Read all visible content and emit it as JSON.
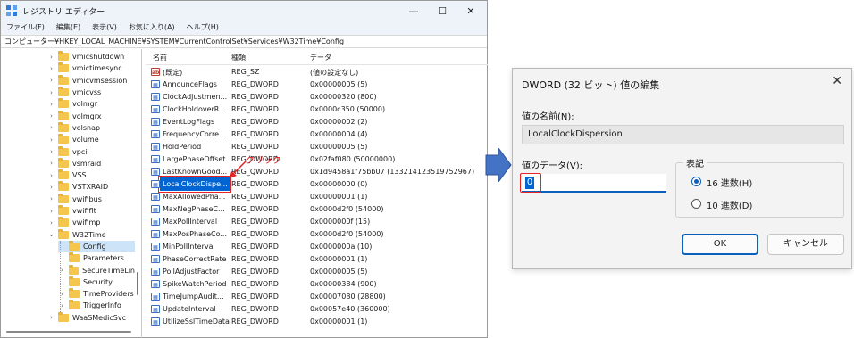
{
  "regedit": {
    "title": "レジストリ エディター",
    "menus": [
      "ファイル(F)",
      "編集(E)",
      "表示(V)",
      "お気に入り(A)",
      "ヘルプ(H)"
    ],
    "address": "コンピューター¥HKEY_LOCAL_MACHINE¥SYSTEM¥CurrentControlSet¥Services¥W32Time¥Config",
    "tree": [
      {
        "label": "vmicshutdown",
        "level": 0,
        "expander": "›"
      },
      {
        "label": "vmictimesync",
        "level": 0,
        "expander": "›"
      },
      {
        "label": "vmicvmsession",
        "level": 0,
        "expander": "›"
      },
      {
        "label": "vmicvss",
        "level": 0,
        "expander": "›"
      },
      {
        "label": "volmgr",
        "level": 0,
        "expander": "›"
      },
      {
        "label": "volmgrx",
        "level": 0,
        "expander": "›"
      },
      {
        "label": "volsnap",
        "level": 0,
        "expander": "›"
      },
      {
        "label": "volume",
        "level": 0,
        "expander": "›"
      },
      {
        "label": "vpci",
        "level": 0,
        "expander": "›"
      },
      {
        "label": "vsmraid",
        "level": 0,
        "expander": "›"
      },
      {
        "label": "VSS",
        "level": 0,
        "expander": "›"
      },
      {
        "label": "VSTXRAID",
        "level": 0,
        "expander": "›"
      },
      {
        "label": "vwifibus",
        "level": 0,
        "expander": "›"
      },
      {
        "label": "vwififlt",
        "level": 0,
        "expander": "›"
      },
      {
        "label": "vwifimp",
        "level": 0,
        "expander": "›"
      },
      {
        "label": "W32Time",
        "level": 0,
        "expander": "⌄"
      },
      {
        "label": "Config",
        "level": 1,
        "expander": "",
        "selected": true
      },
      {
        "label": "Parameters",
        "level": 1,
        "expander": ""
      },
      {
        "label": "SecureTimeLin",
        "level": 1,
        "expander": "›"
      },
      {
        "label": "Security",
        "level": 1,
        "expander": ""
      },
      {
        "label": "TimeProviders",
        "level": 1,
        "expander": "›"
      },
      {
        "label": "TriggerInfo",
        "level": 1,
        "expander": "›"
      },
      {
        "label": "WaaSMedicSvc",
        "level": 0,
        "expander": "›"
      }
    ],
    "columns": {
      "name": "名前",
      "type": "種類",
      "data": "データ"
    },
    "values": [
      {
        "icon": "ab",
        "name": "(既定)",
        "type": "REG_SZ",
        "data": "(値の設定なし)"
      },
      {
        "icon": "dw",
        "name": "AnnounceFlags",
        "type": "REG_DWORD",
        "data": "0x00000005 (5)"
      },
      {
        "icon": "dw",
        "name": "ClockAdjustmen...",
        "type": "REG_DWORD",
        "data": "0x00000320 (800)"
      },
      {
        "icon": "dw",
        "name": "ClockHoldoverR...",
        "type": "REG_DWORD",
        "data": "0x0000c350 (50000)"
      },
      {
        "icon": "dw",
        "name": "EventLogFlags",
        "type": "REG_DWORD",
        "data": "0x00000002 (2)"
      },
      {
        "icon": "dw",
        "name": "FrequencyCorre...",
        "type": "REG_DWORD",
        "data": "0x00000004 (4)"
      },
      {
        "icon": "dw",
        "name": "HoldPeriod",
        "type": "REG_DWORD",
        "data": "0x00000005 (5)"
      },
      {
        "icon": "dw",
        "name": "LargePhaseOffset",
        "type": "REG_DWORD",
        "data": "0x02faf080 (50000000)"
      },
      {
        "icon": "dw",
        "name": "LastKnownGood...",
        "type": "REG_QWORD",
        "data": "0x1d9458a1f75bb07 (133214123519752967)"
      },
      {
        "icon": "dw",
        "name": "LocalClockDispe...",
        "type": "REG_DWORD",
        "data": "0x00000000 (0)",
        "highlighted": true
      },
      {
        "icon": "dw",
        "name": "MaxAllowedPha...",
        "type": "REG_DWORD",
        "data": "0x00000001 (1)"
      },
      {
        "icon": "dw",
        "name": "MaxNegPhaseC...",
        "type": "REG_DWORD",
        "data": "0x0000d2f0 (54000)"
      },
      {
        "icon": "dw",
        "name": "MaxPollInterval",
        "type": "REG_DWORD",
        "data": "0x0000000f (15)"
      },
      {
        "icon": "dw",
        "name": "MaxPosPhaseCo...",
        "type": "REG_DWORD",
        "data": "0x0000d2f0 (54000)"
      },
      {
        "icon": "dw",
        "name": "MinPollInterval",
        "type": "REG_DWORD",
        "data": "0x0000000a (10)"
      },
      {
        "icon": "dw",
        "name": "PhaseCorrectRate",
        "type": "REG_DWORD",
        "data": "0x00000001 (1)"
      },
      {
        "icon": "dw",
        "name": "PollAdjustFactor",
        "type": "REG_DWORD",
        "data": "0x00000005 (5)"
      },
      {
        "icon": "dw",
        "name": "SpikeWatchPeriod",
        "type": "REG_DWORD",
        "data": "0x00000384 (900)"
      },
      {
        "icon": "dw",
        "name": "TimeJumpAudit...",
        "type": "REG_DWORD",
        "data": "0x00007080 (28800)"
      },
      {
        "icon": "dw",
        "name": "UpdateInterval",
        "type": "REG_DWORD",
        "data": "0x00057e40 (360000)"
      },
      {
        "icon": "dw",
        "name": "UtilizeSslTimeData",
        "type": "REG_DWORD",
        "data": "0x00000001 (1)"
      }
    ],
    "click_annotation": "クリック",
    "accent_color": "#0064d2",
    "annotation_color": "#e62222"
  },
  "dialog": {
    "title": "DWORD (32 ビット) 値の編集",
    "name_label": "値の名前(N):",
    "name_value": "LocalClockDispersion",
    "data_label": "値のデータ(V):",
    "data_value": "0",
    "radix_label": "表記",
    "radix_options": [
      {
        "label": "16 進数(H)",
        "selected": true
      },
      {
        "label": "10 進数(D)",
        "selected": false
      }
    ],
    "ok_label": "OK",
    "cancel_label": "キャンセル"
  },
  "icons": {
    "close": "✕",
    "minimize": "—",
    "maximize": "☐",
    "app": "registry-editor-icon",
    "arrow": "blue-right-arrow"
  }
}
